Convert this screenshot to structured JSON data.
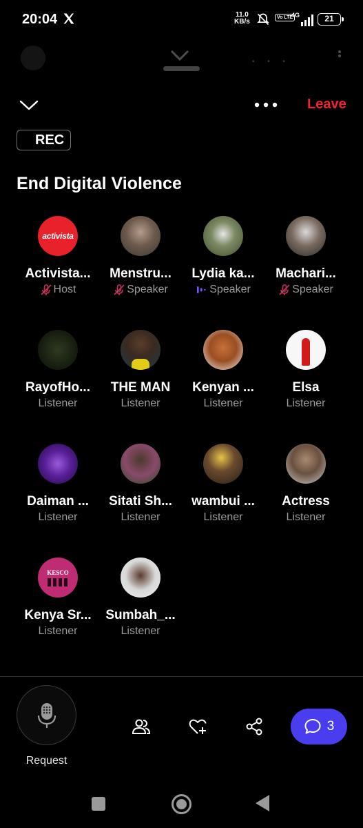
{
  "status_bar": {
    "time": "20:04",
    "net_speed_value": "11.0",
    "net_speed_unit": "KB/s",
    "volte": "Vo LTE",
    "network": "4G",
    "battery": "21"
  },
  "space": {
    "leave_label": "Leave",
    "rec_label": "REC",
    "title": "End Digital Violence"
  },
  "participants": [
    {
      "name": "Activista...",
      "role": "Host",
      "role_icon": "mic-muted-icon",
      "avatar_text": "activista"
    },
    {
      "name": "Menstru...",
      "role": "Speaker",
      "role_icon": "mic-muted-icon"
    },
    {
      "name": "Lydia ka...",
      "role": "Speaker",
      "role_icon": "speaking-bars-icon"
    },
    {
      "name": "Machari...",
      "role": "Speaker",
      "role_icon": "mic-muted-icon"
    },
    {
      "name": "RayofHo...",
      "role": "Listener"
    },
    {
      "name": "THE MAN",
      "role": "Listener"
    },
    {
      "name": "Kenyan ...",
      "role": "Listener"
    },
    {
      "name": "Elsa",
      "role": "Listener"
    },
    {
      "name": "Daiman ...",
      "role": "Listener"
    },
    {
      "name": "Sitati Sh...",
      "role": "Listener"
    },
    {
      "name": "wambui ...",
      "role": "Listener"
    },
    {
      "name": "Actress",
      "role": "Listener"
    },
    {
      "name": "Kenya Sr...",
      "role": "Listener",
      "avatar_text": "KESCO"
    },
    {
      "name": "Sumbah_...",
      "role": "Listener"
    }
  ],
  "bottom_bar": {
    "request_label": "Request",
    "chat_count": "3"
  },
  "colors": {
    "leave": "#f4212e",
    "chat_button": "#4a3df0",
    "speaking_indicator": "#7856ff",
    "muted_icon": "#c8325a"
  }
}
